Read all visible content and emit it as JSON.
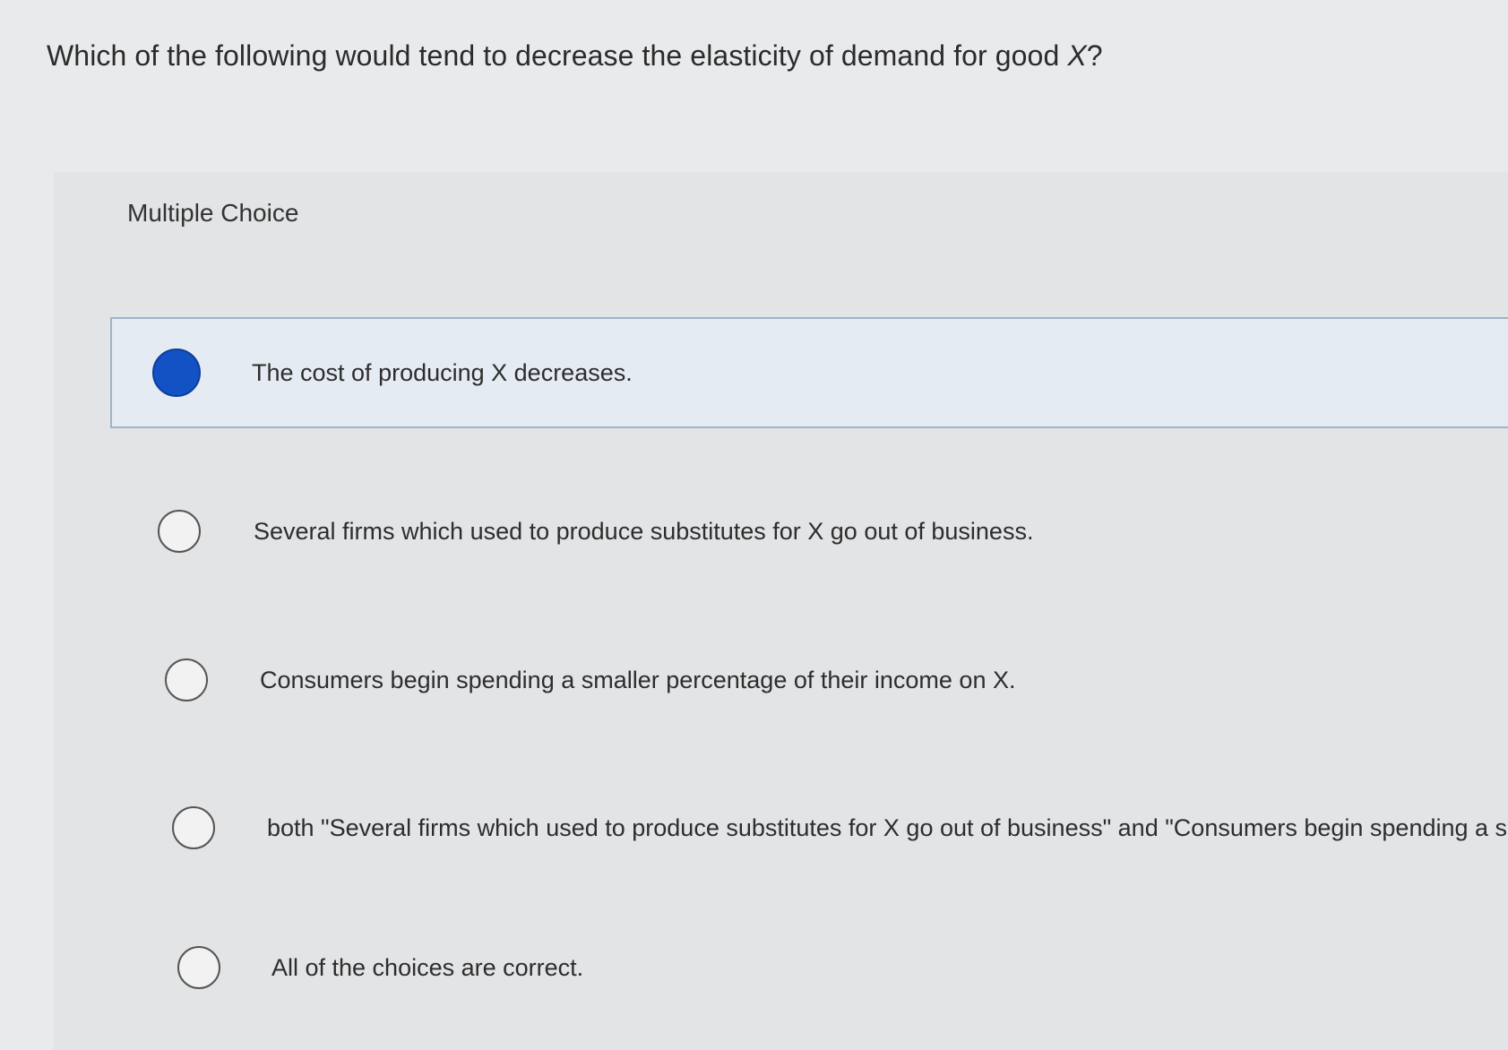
{
  "question": {
    "text_before": "Which of the following would tend to decrease the elasticity of demand for good ",
    "variable": "X",
    "text_after": "?"
  },
  "section_label": "Multiple Choice",
  "options": [
    {
      "label": "The cost of producing X decreases.",
      "selected": true
    },
    {
      "label": "Several firms which used to produce substitutes for X go out of business.",
      "selected": false
    },
    {
      "label": "Consumers begin spending a smaller percentage of their income on X.",
      "selected": false
    },
    {
      "label": "both \"Several firms which used to produce substitutes for X go out of business\" and \"Consumers begin spending a smaller",
      "selected": false
    },
    {
      "label": "All of the choices are correct.",
      "selected": false
    }
  ],
  "colors": {
    "selected_radio": "#1252c4",
    "selected_row_bg": "#e4ebf2"
  }
}
